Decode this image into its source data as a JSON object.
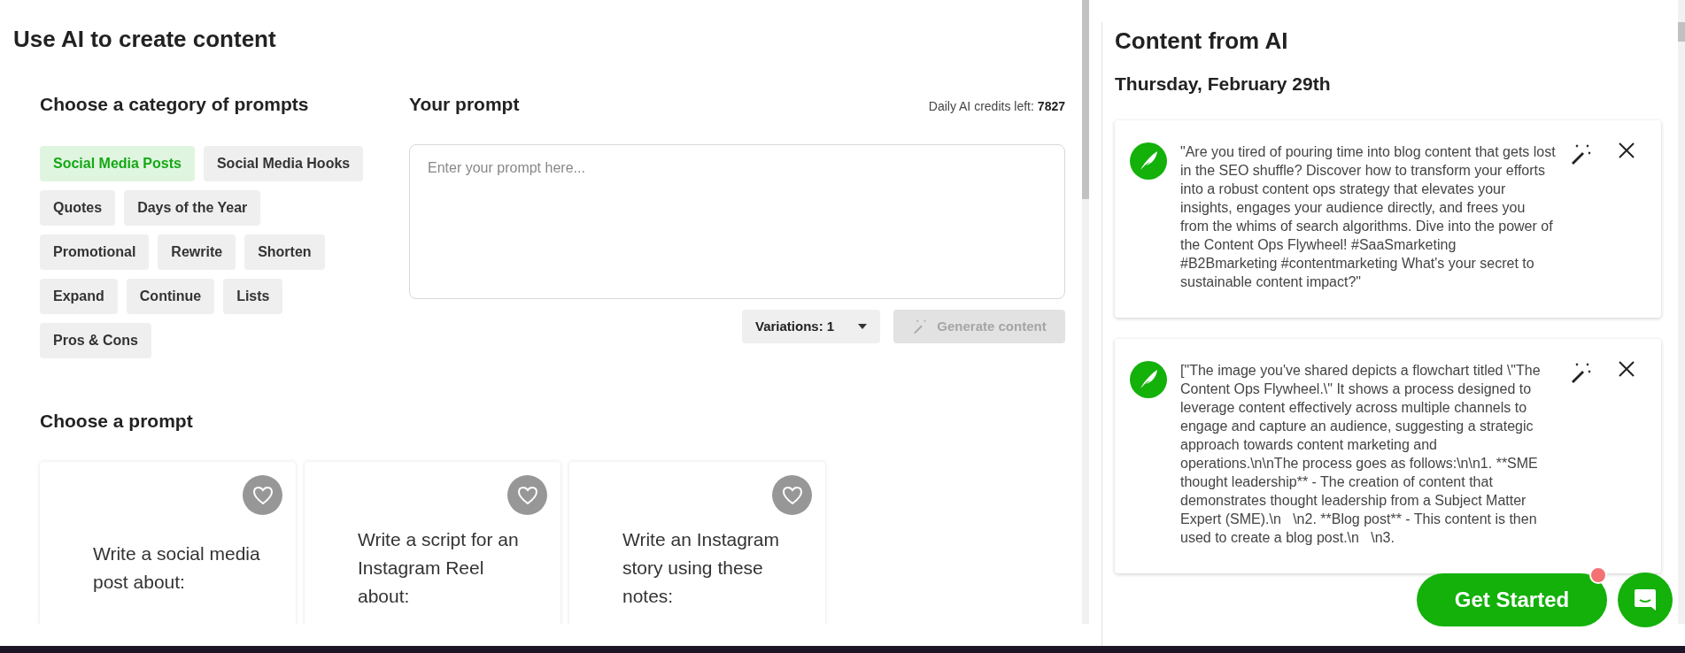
{
  "editor": {
    "title": "Use AI to create content",
    "categories_heading": "Choose a category of prompts",
    "categories": [
      {
        "label": "Social Media Posts",
        "selected": true
      },
      {
        "label": "Social Media Hooks",
        "selected": false
      },
      {
        "label": "Quotes",
        "selected": false
      },
      {
        "label": "Days of the Year",
        "selected": false
      },
      {
        "label": "Promotional",
        "selected": false
      },
      {
        "label": "Rewrite",
        "selected": false
      },
      {
        "label": "Shorten",
        "selected": false
      },
      {
        "label": "Expand",
        "selected": false
      },
      {
        "label": "Continue",
        "selected": false
      },
      {
        "label": "Lists",
        "selected": false
      },
      {
        "label": "Pros & Cons",
        "selected": false
      }
    ],
    "prompt_heading": "Your prompt",
    "credits_label": "Daily AI credits left:",
    "credits_value": "7827",
    "prompt_field": {
      "placeholder": "Enter your prompt here..."
    },
    "variations": "Variations: 1",
    "generate": {
      "label": "Generate content",
      "disabled": true
    },
    "prompts_heading": "Choose a prompt",
    "prompts": [
      {
        "text": "Write a social media post about:"
      },
      {
        "text": "Write a script for an Instagram Reel about:"
      },
      {
        "text": "Write an Instagram story using these notes:"
      }
    ]
  },
  "results": {
    "title": "Content from AI",
    "date": "Thursday, February 29th",
    "items": [
      {
        "text": "\"Are you tired of pouring time into blog content that gets lost in the SEO shuffle? Discover how to transform your efforts into a robust content ops strategy that elevates your insights, engages your audience directly, and frees you from the whims of search algorithms. Dive into the power of the Content Ops Flywheel! #SaaSmarketing #B2Bmarketing #contentmarketing What's your secret to sustainable content impact?\""
      },
      {
        "text": "[\"The image you've shared depicts a flowchart titled \\\"The Content Ops Flywheel.\\\" It shows a process designed to leverage content effectively across multiple channels to engage and capture an audience, suggesting a strategic approach towards content marketing and operations.\\n\\nThe process goes as follows:\\n\\n1. **SME thought leadership** - The creation of content that demonstrates thought leadership from a Subject Matter Expert (SME).\\n   \\n2. **Blog post** - This content is then used to create a blog post.\\n   \\n3."
      }
    ]
  },
  "cta": {
    "label": "Get Started",
    "notification": true
  }
}
